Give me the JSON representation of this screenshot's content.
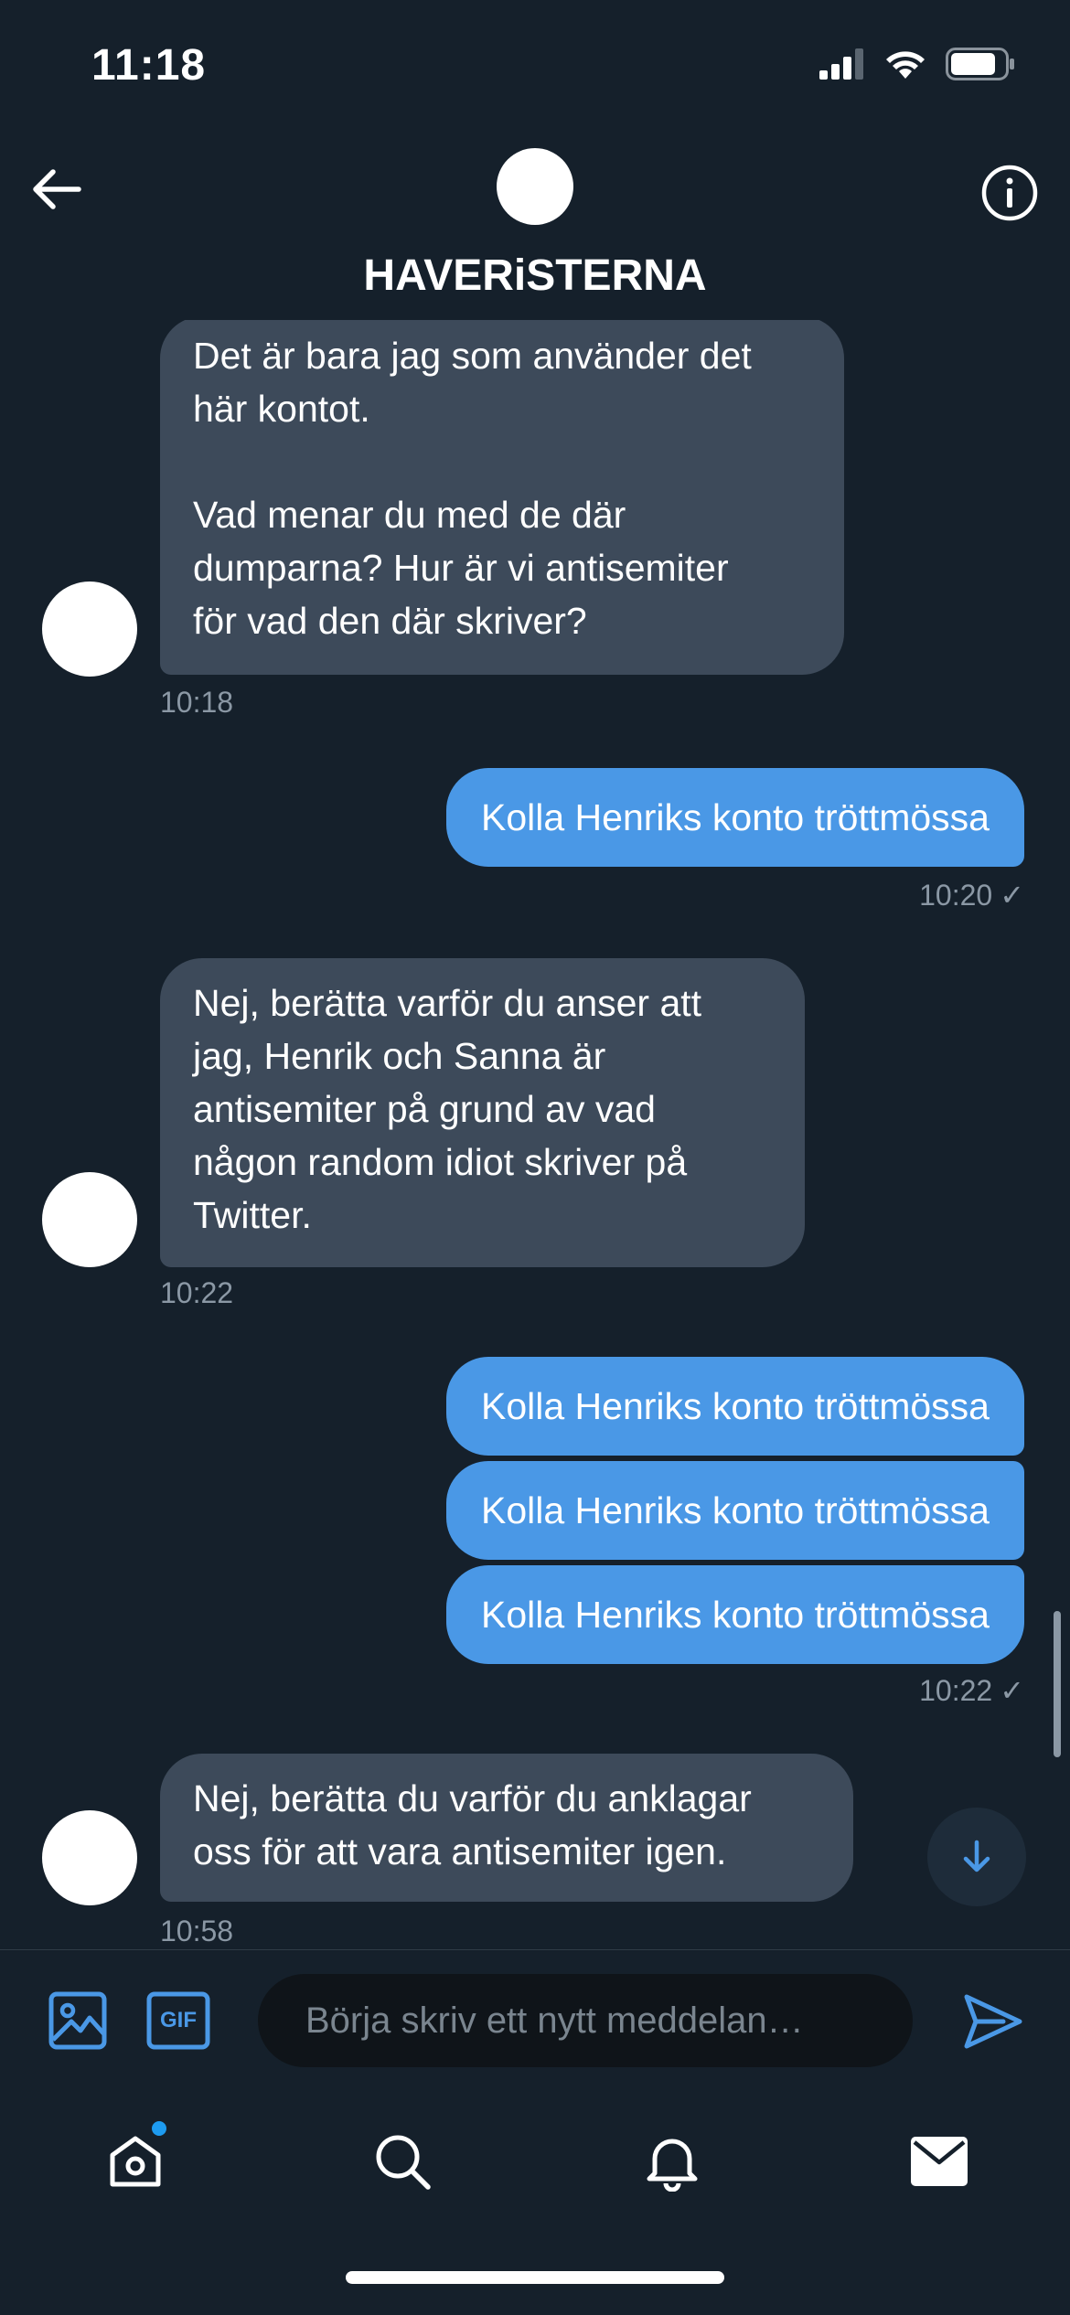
{
  "status_bar": {
    "time": "11:18"
  },
  "header": {
    "title": "HAVERiSTERNA",
    "avatar_emoji": "😂",
    "back_icon": "arrow-left-icon",
    "info_icon": "info-icon"
  },
  "messages": [
    {
      "direction": "in",
      "text": "Det är bara jag som använder det\nhär kontot.\n\nVad menar du med de där\ndumparna? Hur är vi antisemiter\nför vad den där skriver?",
      "time": "10:18"
    },
    {
      "direction": "out",
      "text": "Kolla Henriks konto tröttmössa",
      "time": "10:20"
    },
    {
      "direction": "in",
      "text": "Nej, berätta varför du anser att\njag, Henrik och Sanna är\nantisemiter på grund av vad\nnågon random idiot skriver på\nTwitter.",
      "time": "10:22"
    },
    {
      "direction": "out",
      "text": "Kolla Henriks konto tröttmössa"
    },
    {
      "direction": "out",
      "text": "Kolla Henriks konto tröttmössa"
    },
    {
      "direction": "out",
      "text": "Kolla Henriks konto tröttmössa",
      "time": "10:22"
    },
    {
      "direction": "in",
      "text": "Nej, berätta du varför du anklagar\noss för att vara antisemiter igen.",
      "time": "10:58"
    }
  ],
  "avatar_emoji": "😂",
  "check_mark": "✓",
  "composer": {
    "placeholder": "Börja skriv ett nytt meddelan…",
    "gif_label": "GIF"
  },
  "tabbar": {
    "items": [
      "home-icon",
      "search-icon",
      "bell-icon",
      "mail-icon"
    ],
    "home_has_notification": true
  },
  "colors": {
    "background": "#15202b",
    "incoming_bubble": "#3d4a5a",
    "outgoing_bubble": "#4a98e6",
    "accent": "#1d9bf0"
  }
}
